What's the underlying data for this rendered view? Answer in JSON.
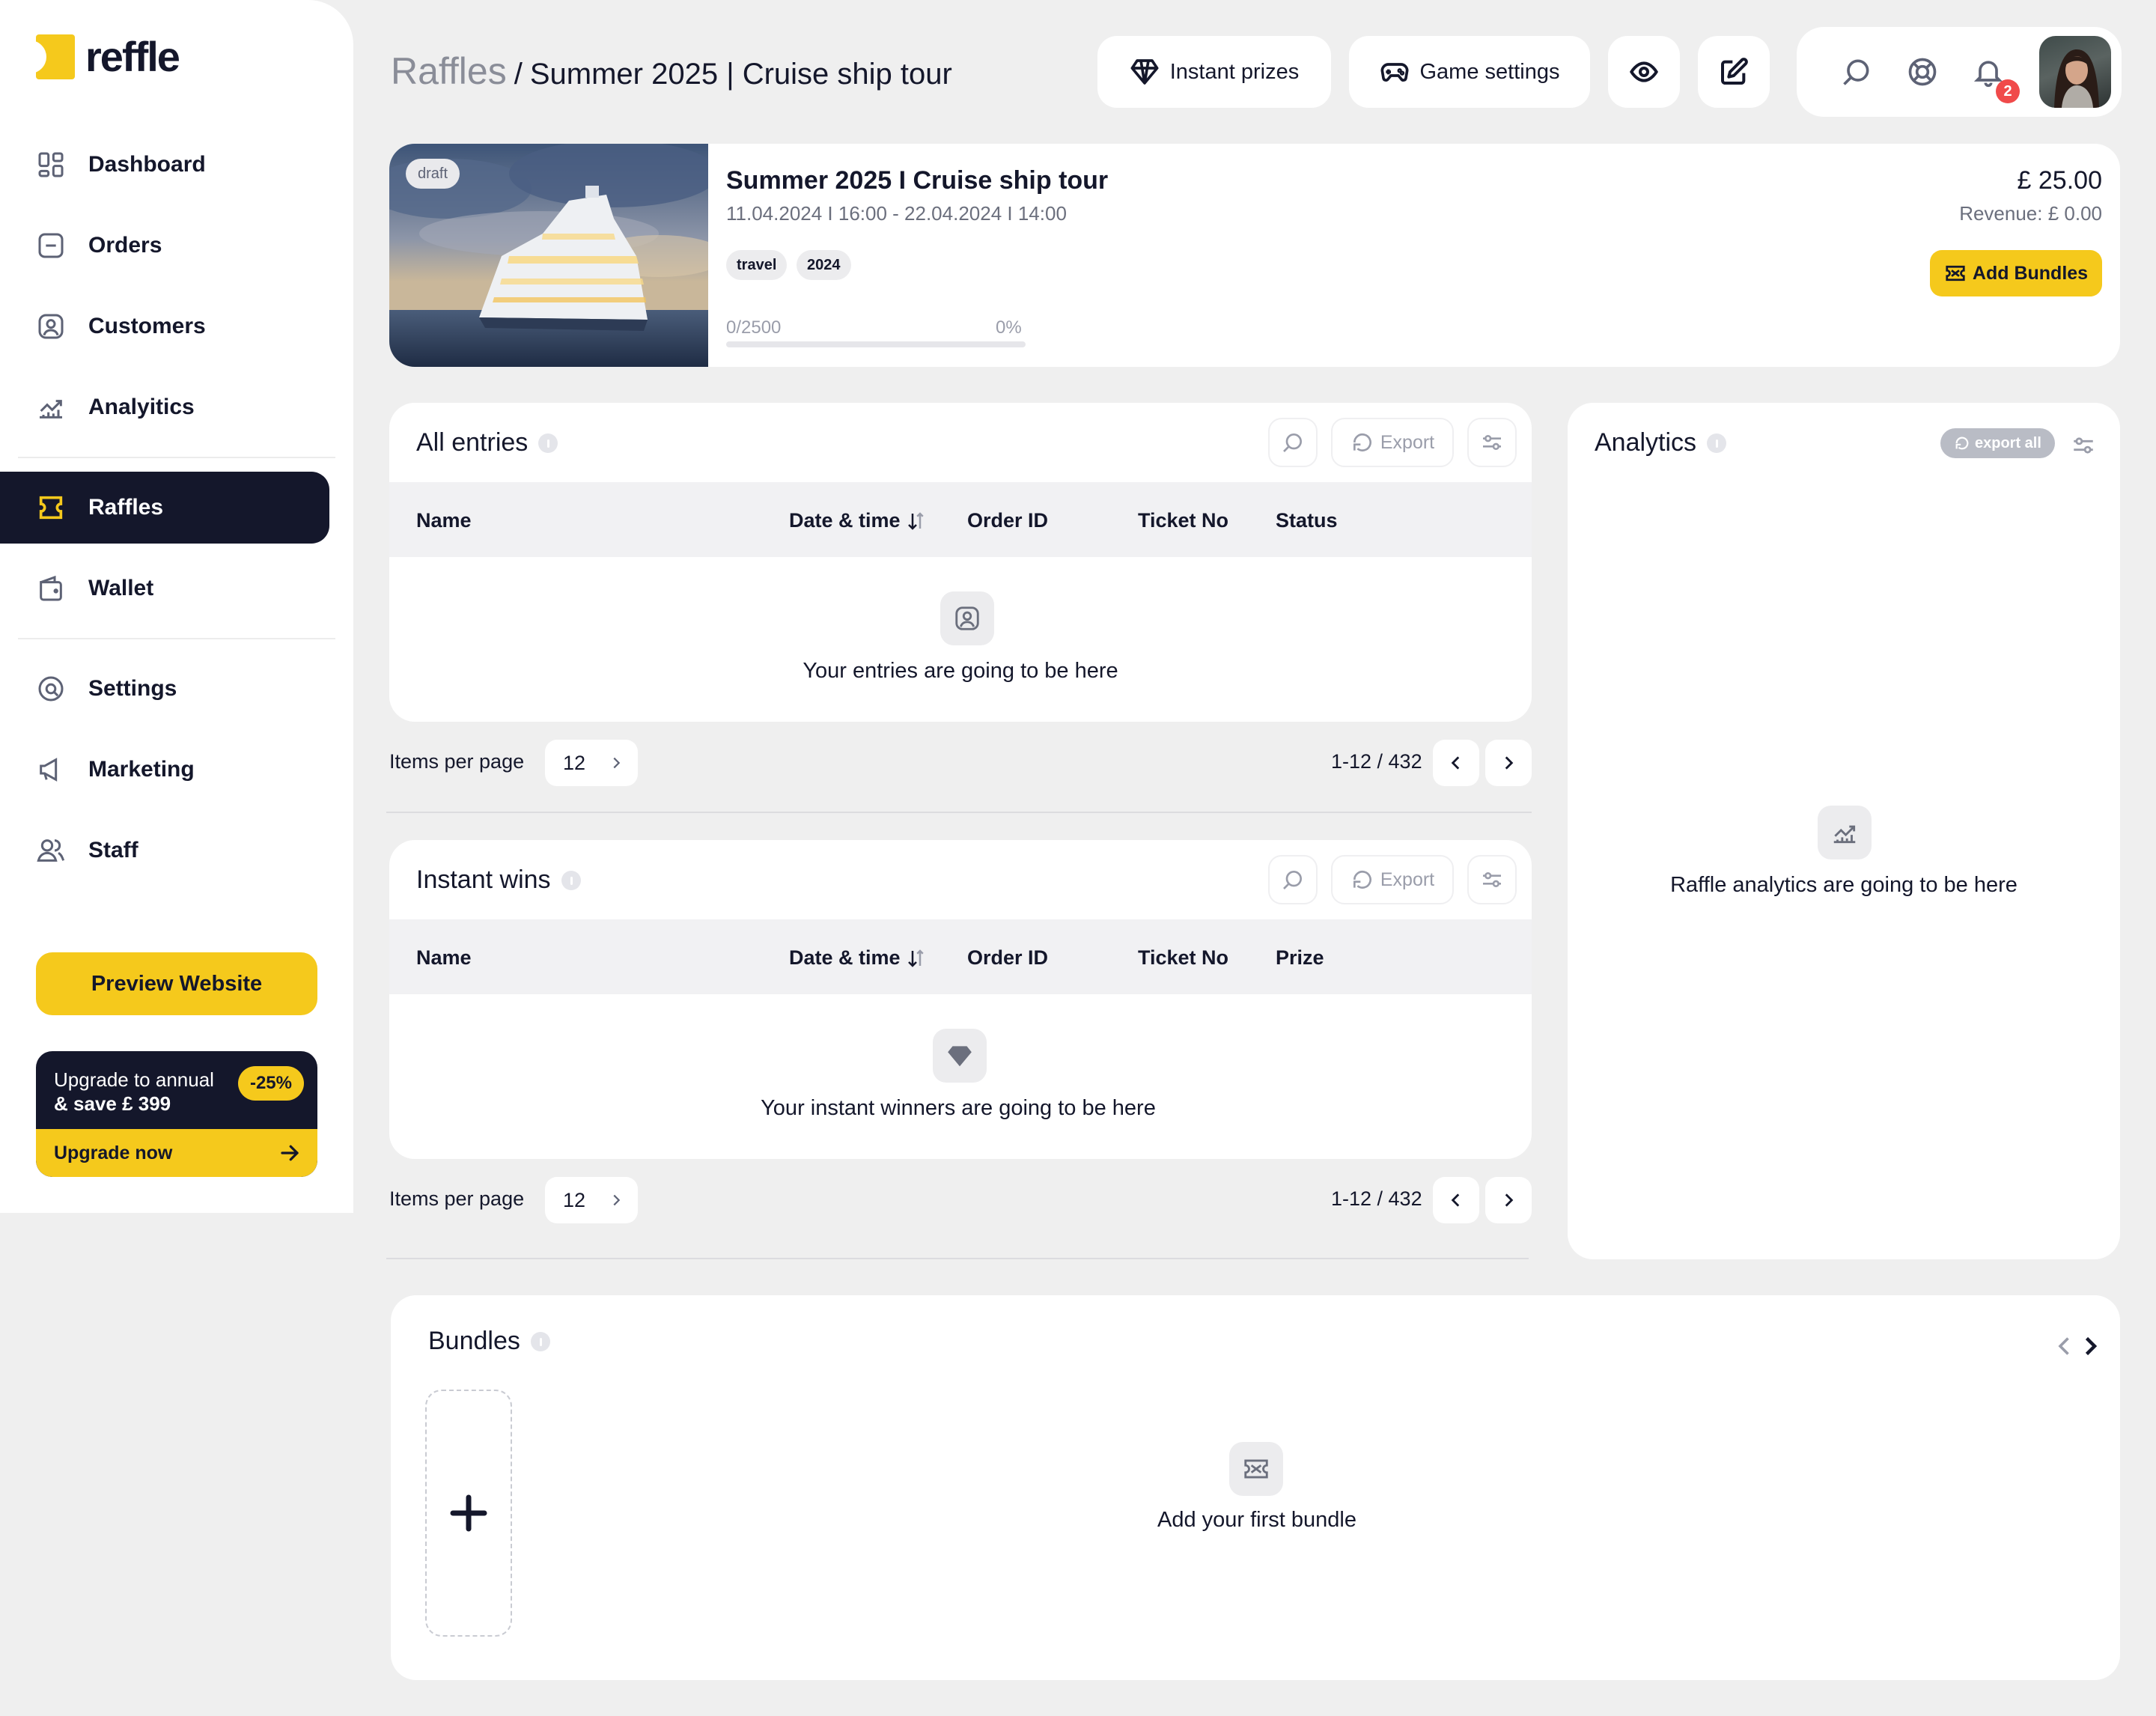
{
  "brand": {
    "name": "reffle",
    "accent": "#f5c91c",
    "dark": "#14172b"
  },
  "sidebar": {
    "items": [
      {
        "label": "Dashboard",
        "icon": "dashboard-icon"
      },
      {
        "label": "Orders",
        "icon": "orders-icon"
      },
      {
        "label": "Customers",
        "icon": "customers-icon"
      },
      {
        "label": "Analyitics",
        "icon": "analytics-icon"
      },
      {
        "label": "Raffles",
        "icon": "ticket-icon",
        "active": true
      },
      {
        "label": "Wallet",
        "icon": "wallet-icon"
      },
      {
        "label": "Settings",
        "icon": "settings-icon"
      },
      {
        "label": "Marketing",
        "icon": "megaphone-icon"
      },
      {
        "label": "Staff",
        "icon": "staff-icon"
      }
    ],
    "preview_button": "Preview Website",
    "upgrade": {
      "line1": "Upgrade to annual",
      "line2": "& save £ 399",
      "discount": "-25%",
      "cta": "Upgrade now"
    }
  },
  "header": {
    "breadcrumb_root": "Raffles",
    "breadcrumb_sep": "/",
    "breadcrumb_current": "Summer 2025 | Cruise ship tour",
    "instant_prizes": "Instant prizes",
    "game_settings": "Game settings",
    "notification_count": "2"
  },
  "raffle": {
    "status": "draft",
    "title": "Summer 2025 I Cruise ship tour",
    "dates": "11.04.2024 I 16:00 - 22.04.2024 I 14:00",
    "tags": [
      "travel",
      "2024"
    ],
    "progress_label": "0/2500",
    "progress_pct": "0%",
    "progress_value": 0,
    "price": "£ 25.00",
    "revenue": "Revenue: £ 0.00",
    "add_bundles": "Add Bundles"
  },
  "entries": {
    "title": "All entries",
    "export": "Export",
    "columns": [
      "Name",
      "Date & time",
      "Order ID",
      "Ticket No",
      "Status"
    ],
    "empty_text": "Your entries are going to be here",
    "items_per_page_label": "Items per page",
    "items_per_page": "12",
    "range": "1-12 / 432"
  },
  "instant_wins": {
    "title": "Instant wins",
    "export": "Export",
    "columns": [
      "Name",
      "Date & time",
      "Order ID",
      "Ticket No",
      "Prize"
    ],
    "empty_text": "Your instant winners are going to be here",
    "items_per_page_label": "Items per page",
    "items_per_page": "12",
    "range": "1-12 / 432"
  },
  "analytics": {
    "title": "Analytics",
    "export_all": "export all",
    "empty_text": "Raffle analytics are going to be here"
  },
  "bundles": {
    "title": "Bundles",
    "empty_text": "Add your first bundle"
  }
}
